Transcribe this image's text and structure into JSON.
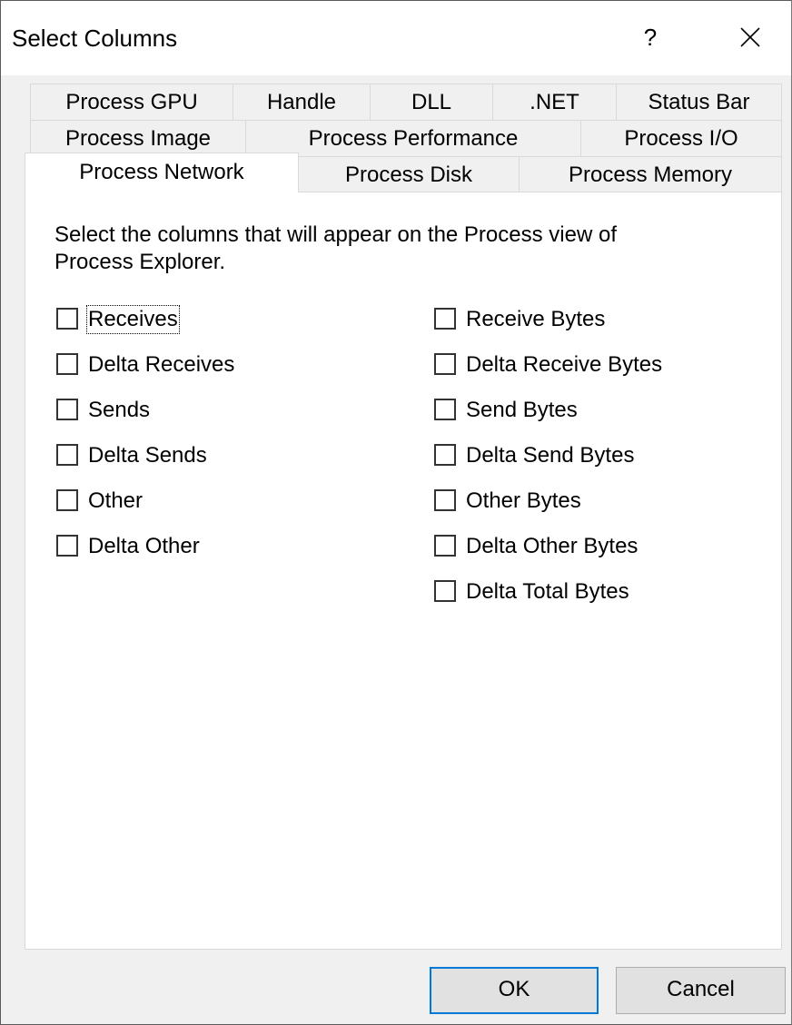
{
  "dialog": {
    "title": "Select Columns",
    "help_label": "?",
    "close_icon": "close-icon"
  },
  "tabs": {
    "row1": [
      "Process GPU",
      "Handle",
      "DLL",
      ".NET",
      "Status Bar"
    ],
    "row2": [
      "Process Image",
      "Process Performance",
      "Process I/O"
    ],
    "row3": [
      "Process Network",
      "Process Disk",
      "Process Memory"
    ],
    "active": "Process Network"
  },
  "panel": {
    "description": "Select the columns that will appear on the Process view of Process Explorer.",
    "left_column": [
      {
        "label": "Receives",
        "checked": false
      },
      {
        "label": "Delta Receives",
        "checked": false
      },
      {
        "label": "Sends",
        "checked": false
      },
      {
        "label": "Delta Sends",
        "checked": false
      },
      {
        "label": "Other",
        "checked": false
      },
      {
        "label": "Delta Other",
        "checked": false
      }
    ],
    "right_column": [
      {
        "label": "Receive Bytes",
        "checked": false
      },
      {
        "label": "Delta Receive Bytes",
        "checked": false
      },
      {
        "label": "Send Bytes",
        "checked": false
      },
      {
        "label": "Delta Send Bytes",
        "checked": false
      },
      {
        "label": "Other Bytes",
        "checked": false
      },
      {
        "label": "Delta Other Bytes",
        "checked": false
      },
      {
        "label": "Delta Total Bytes",
        "checked": false
      }
    ]
  },
  "buttons": {
    "ok_label": "OK",
    "cancel_label": "Cancel"
  },
  "colors": {
    "default_button_border": "#0078d7",
    "dialog_background": "#f0f0f0",
    "panel_background": "#ffffff"
  }
}
